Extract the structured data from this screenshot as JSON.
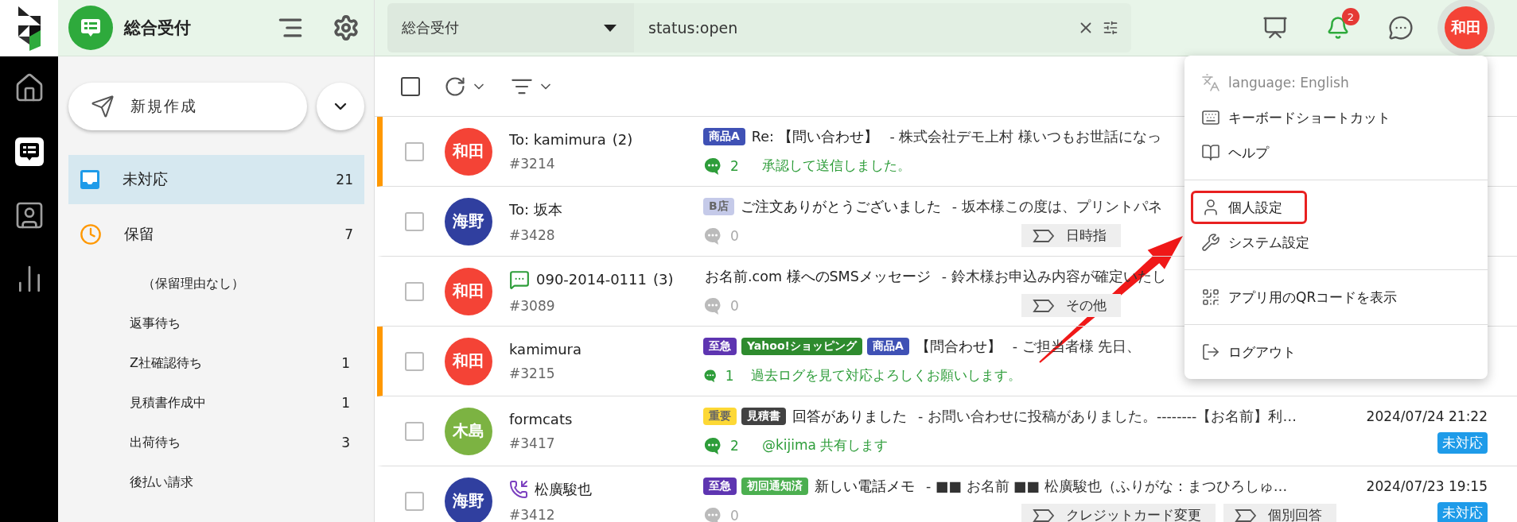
{
  "rail": {
    "items": [
      {
        "kind": "home",
        "selected": false
      },
      {
        "kind": "inbox",
        "selected": true
      },
      {
        "kind": "contacts",
        "selected": false
      },
      {
        "kind": "analytics",
        "selected": false
      }
    ]
  },
  "sidebar": {
    "title": "総合受付",
    "compose": "新規作成",
    "folders": [
      {
        "kind": "open",
        "label": "未対応",
        "count": "21",
        "selected": true
      },
      {
        "kind": "hold",
        "label": "保留",
        "count": "7",
        "selected": false
      }
    ],
    "hold_reasons": [
      {
        "label": "（保留理由なし）"
      },
      {
        "label": "返事待ち"
      },
      {
        "label": "Z社確認待ち",
        "count": "1"
      },
      {
        "label": "見積書作成中",
        "count": "1"
      },
      {
        "label": "出荷待ち",
        "count": "3"
      },
      {
        "label": "後払い請求"
      }
    ]
  },
  "search": {
    "scope": "総合受付",
    "query": "status:open"
  },
  "toolbar": {
    "select_all_checked": false
  },
  "notifications": {
    "count": "2"
  },
  "user": {
    "initials": "和田",
    "color": "#f44336"
  },
  "rows": [
    {
      "checked": false,
      "flagged": true,
      "initials": "和田",
      "color": "#f44336",
      "kind": "mail",
      "sender": "To: kamimura",
      "thread_count": "(2)",
      "id": "#3214",
      "tags": [
        {
          "label": "商品A",
          "color": "#3f51b5"
        }
      ],
      "subject": "Re: 【問い合わせ】",
      "preview": "- 株式会社デモ上村 様いつもお世話になっ",
      "comments": "2",
      "commented": true,
      "note": "承認して送信しました。",
      "labels": []
    },
    {
      "checked": false,
      "flagged": false,
      "initials": "海野",
      "color": "#303f9f",
      "kind": "mail",
      "sender": "To: 坂本",
      "id": "#3428",
      "tags": [
        {
          "label": "B店",
          "color": "#c5cae9"
        }
      ],
      "subject": "ご注文ありがとうございました",
      "preview": "- 坂本様この度は、プリントパネ",
      "comments": "0",
      "commented": false,
      "labels": [
        "日時指"
      ]
    },
    {
      "checked": false,
      "flagged": false,
      "initials": "和田",
      "color": "#f44336",
      "kind": "sms",
      "sender": "090-2014-0111",
      "thread_count": "(3)",
      "id": "#3089",
      "tags": [],
      "subject": "お名前.com 様へのSMSメッセージ",
      "preview": "- 鈴木様お申込み内容が確定いたし",
      "comments": "0",
      "commented": false,
      "labels": [
        "その他"
      ]
    },
    {
      "checked": false,
      "flagged": true,
      "initials": "和田",
      "color": "#f44336",
      "kind": "mail",
      "sender": "kamimura",
      "id": "#3215",
      "tags": [
        {
          "label": "至急",
          "color": "#5e35b1"
        },
        {
          "label": "Yahoo!ショッピング",
          "color": "#2e8b2e"
        },
        {
          "label": "商品A",
          "color": "#3f51b5"
        }
      ],
      "subject": "【問合わせ】",
      "preview": "- ご担当者様 先日、",
      "comments": "1",
      "commented": true,
      "note": "過去ログを見て対応よろしくお願いします。",
      "labels": []
    },
    {
      "checked": false,
      "flagged": false,
      "initials": "木島",
      "color": "#7cb342",
      "kind": "mail",
      "sender": "formcats",
      "id": "#3417",
      "tags": [
        {
          "label": "重要",
          "color": "#fdd835"
        },
        {
          "label": "見積書",
          "color": "#424242"
        }
      ],
      "subject": "回答がありました",
      "preview": "- お問い合わせに投稿がありました。--------【お名前】利…",
      "date": "2024/07/24 21:22",
      "status": "未対応",
      "comments": "2",
      "commented": true,
      "note": "@kijima 共有します",
      "labels": []
    },
    {
      "checked": false,
      "flagged": false,
      "initials": "海野",
      "color": "#303f9f",
      "kind": "phone",
      "sender": "松廣駿也",
      "id": "#3412",
      "tags": [
        {
          "label": "至急",
          "color": "#5e35b1"
        },
        {
          "label": "初回通知済",
          "color": "#4caf50"
        }
      ],
      "subject": "新しい電話メモ",
      "preview": "- ■■ お名前 ■■ 松廣駿也（ふりがな：まつひろしゅ…",
      "date": "2024/07/23 19:15",
      "status": "未対応",
      "comments": "0",
      "commented": false,
      "labels": [
        "クレジットカード変更",
        "個別回答"
      ]
    }
  ],
  "user_menu": {
    "sections": [
      {
        "items": [
          {
            "kind": "language",
            "label": "language: English",
            "disabled": true,
            "highlighted": false
          },
          {
            "kind": "keyboard",
            "label": "キーボードショートカット",
            "disabled": false,
            "highlighted": false
          },
          {
            "kind": "help",
            "label": "ヘルプ",
            "disabled": false,
            "highlighted": false
          }
        ]
      },
      {
        "items": [
          {
            "kind": "profile",
            "label": "個人設定",
            "disabled": false,
            "highlighted": true
          },
          {
            "kind": "system",
            "label": "システム設定",
            "disabled": false,
            "highlighted": false
          }
        ]
      },
      {
        "items": [
          {
            "kind": "qr",
            "label": "アプリ用のQRコードを表示",
            "disabled": false,
            "highlighted": false
          }
        ]
      },
      {
        "items": [
          {
            "kind": "logout",
            "label": "ログアウト",
            "disabled": false,
            "highlighted": false
          }
        ]
      }
    ]
  },
  "annotation": {
    "kind": "arrow"
  }
}
